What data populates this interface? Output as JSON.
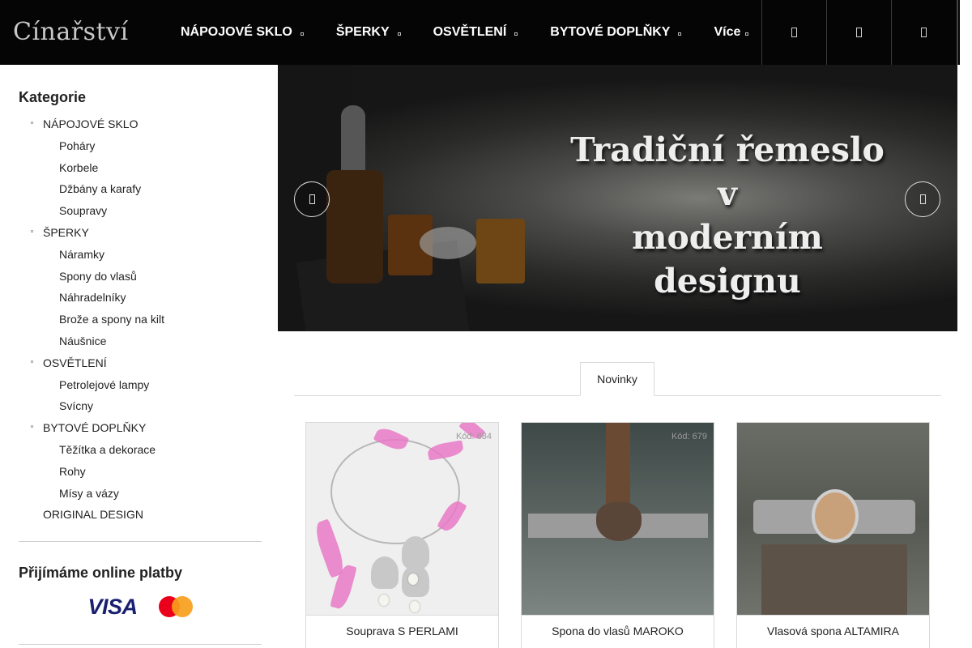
{
  "header": {
    "logo": "Cínařství",
    "nav": [
      {
        "label": "NÁPOJOVÉ SKLO"
      },
      {
        "label": "ŠPERKY"
      },
      {
        "label": "OSVĚTLENÍ"
      },
      {
        "label": "BYTOVÉ DOPLŇKY"
      },
      {
        "label": "Více"
      }
    ],
    "icons": [
      "search-icon",
      "user-icon",
      "cart-icon"
    ]
  },
  "sidebar": {
    "categories_title": "Kategorie",
    "categories": [
      {
        "label": "NÁPOJOVÉ SKLO",
        "children": [
          "Poháry",
          "Korbele",
          "Džbány a karafy",
          "Soupravy"
        ]
      },
      {
        "label": "ŠPERKY",
        "children": [
          "Náramky",
          "Spony do vlasů",
          "Náhradelníky",
          "Brože a spony na kilt",
          "Náušnice"
        ]
      },
      {
        "label": "OSVĚTLENÍ",
        "children": [
          "Petrolejové lampy",
          "Svícny"
        ]
      },
      {
        "label": "BYTOVÉ DOPLŇKY",
        "children": [
          "Těžítka a dekorace",
          "Rohy",
          "Mísy a vázy"
        ]
      },
      {
        "label": "ORIGINAL DESIGN",
        "children": []
      }
    ],
    "payments_title": "Přijímáme online platby",
    "payment_logos": {
      "visa": "VISA",
      "mastercard": "mastercard-logo"
    }
  },
  "banner": {
    "lines": [
      "Tradiční řemeslo",
      "v",
      "moderním designu"
    ],
    "prev_icon": "chevron-left-icon",
    "next_icon": "chevron-right-icon"
  },
  "tabs": [
    {
      "label": "Novinky",
      "active": true
    }
  ],
  "products": [
    {
      "code": "Kód: 684",
      "name": "Souprava S PERLAMI"
    },
    {
      "code": "Kód: 679",
      "name": "Spona do vlasů MAROKO"
    },
    {
      "code": "",
      "name": "Vlasová spona ALTAMIRA"
    }
  ],
  "colors": {
    "header_bg": "#050505",
    "accent": "#ffffff",
    "border": "#dadada"
  }
}
